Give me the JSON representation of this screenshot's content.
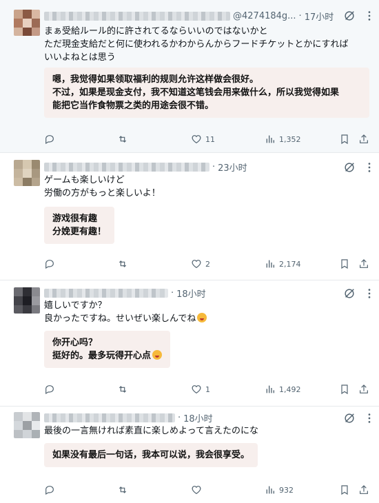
{
  "posts": [
    {
      "handle": "@4274184g...",
      "time": "17小时",
      "jp_lines": [
        "まぁ受給ルール的に許されてるならいいのではないかと",
        "ただ現金支給だと何に使われるかわからんからフードチケットとかにすれば",
        "いいよねとは思う"
      ],
      "tr_lines": [
        "嗯，我觉得如果领取福利的规则允许这样做会很好。",
        "不过，如果是现金支付，我不知道这笔钱会用来做什么，所以我觉得如果",
        "能把它当作食物票之类的用途会很不错。"
      ],
      "stats": {
        "reply": "",
        "repost": "",
        "like": "11",
        "views": "1,352"
      },
      "avatar_colors": [
        "#c9a38a",
        "#8b5a44",
        "#d9b8a3",
        "#b07a60",
        "#e8d0c0",
        "#9c6b55",
        "#d4b49e",
        "#7a4a38",
        "#c49a86"
      ]
    },
    {
      "handle": "",
      "time": "23小时",
      "jp_lines": [
        "ゲームも楽しいけど",
        "労働の方がもっと楽しいよ！"
      ],
      "tr_lines": [
        "游戏很有趣",
        "分娩更有趣！"
      ],
      "stats": {
        "reply": "",
        "repost": "",
        "like": "2",
        "views": "2,174"
      },
      "avatar_colors": [
        "#b8a890",
        "#d6c8b0",
        "#9a8a70",
        "#c4b49c",
        "#e0d4c0",
        "#a89880",
        "#ccbca4",
        "#8c7c64",
        "#b4a48c"
      ]
    },
    {
      "handle": "",
      "time": "18小时",
      "jp_lines": [
        "嬉しいですか？",
        "良かったですね。せいぜい楽しんでね"
      ],
      "tr_lines": [
        "你开心吗？",
        "挺好的。最多玩得开心点"
      ],
      "stats": {
        "reply": "",
        "repost": "",
        "like": "1",
        "views": "1,492"
      },
      "avatar_colors": [
        "#6a6a70",
        "#2e2e34",
        "#8a8a90",
        "#44444a",
        "#1e1e24",
        "#9a9aa0",
        "#5a5a60",
        "#3a3a40",
        "#7a7a80"
      ]
    },
    {
      "handle": "",
      "time": "18小时",
      "jp_lines": [
        "最後の一言無ければ素直に楽しめよって言えたのにな"
      ],
      "tr_lines": [
        "如果没有最后一句话，我本可以说，我会很享受。"
      ],
      "stats": {
        "reply": "",
        "repost": "",
        "like": "",
        "views": "932"
      },
      "avatar_colors": [
        "#c8ccd0",
        "#e2e4e6",
        "#b0b4b8",
        "#d4d8dc",
        "#9ca0a4",
        "#e8eaec",
        "#bcc0c4",
        "#d0d4d8",
        "#aab0b4"
      ]
    }
  ],
  "colors": {
    "translation_bg": "#f7efed",
    "icon": "#536471",
    "first_post_bg": "#f5f8fa"
  }
}
